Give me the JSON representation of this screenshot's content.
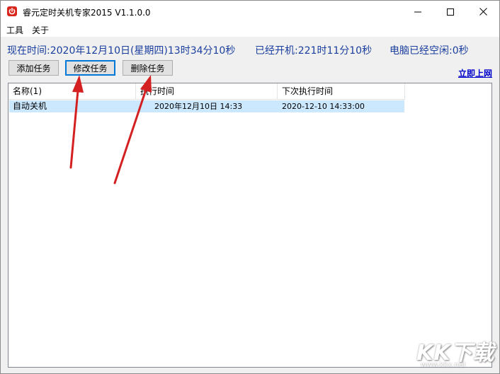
{
  "window": {
    "title": "睿元定时关机专家2015 V1.1.0.0",
    "icon": "power-icon"
  },
  "menu": [
    "工具",
    "关于"
  ],
  "status": {
    "current_time": "现在时间:2020年12月10日(星期四)13时34分10秒",
    "uptime": "已经开机:221时11分10秒",
    "idle": "电脑已经空闲:0秒"
  },
  "toolbar": {
    "add_label": "添加任务",
    "edit_label": "修改任务",
    "delete_label": "删除任务",
    "link_label": "立即上网"
  },
  "table": {
    "columns": [
      "名称(1)",
      "执行时间",
      "下次执行时间"
    ],
    "rows": [
      [
        "自动关机",
        "2020年12月10日 14:33",
        "2020-12-10 14:33:00"
      ]
    ]
  },
  "watermark": {
    "logo": "KK下载",
    "url": "www.kkx.net"
  },
  "colors": {
    "accent": "#0078d7",
    "status_text": "#1a3e9e",
    "selected_row": "#cce8ff",
    "arrow": "#d42020",
    "icon_red": "#d9261c"
  }
}
